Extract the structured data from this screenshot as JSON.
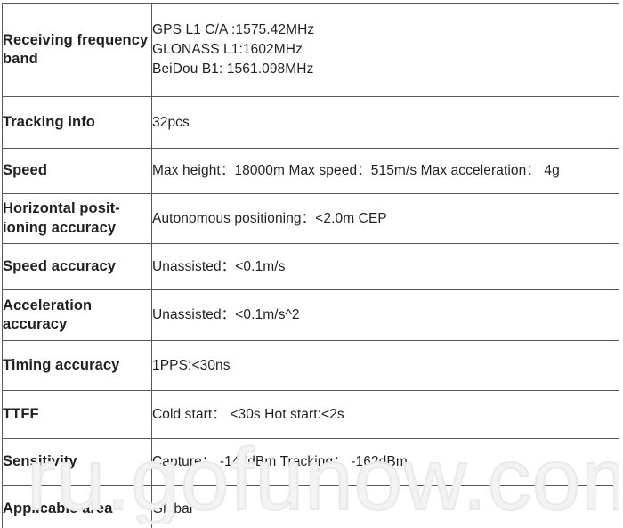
{
  "document": {
    "type": "specification-table",
    "watermark": "ru.gofunow.com",
    "watermark_color": "#e9e9e9",
    "text_color": "#231f20",
    "border_color": "#58595b",
    "background": "#ffffff"
  },
  "table": {
    "column_count": 2,
    "rows": [
      {
        "label": "Receiving\nfrequency band",
        "value": "GPS L1 C/A :1575.42MHz\nGLONASS L1:1602MHz\nBeiDou B1: 1561.098MHz"
      },
      {
        "label": "Tracking info",
        "value": "32pcs"
      },
      {
        "label": "Speed",
        "value": "Max height：18000m  Max speed：515m/s Max acceleration： 4g"
      },
      {
        "label": "Horizontal posit-\nioning accuracy",
        "value": "Autonomous positioning：<2.0m CEP"
      },
      {
        "label": "Speed accuracy",
        "value": "Unassisted：<0.1m/s"
      },
      {
        "label": "Acceleration\naccuracy",
        "value": "Unassisted：<0.1m/s^2"
      },
      {
        "label": "Timing accuracy",
        "value": "1PPS:<30ns"
      },
      {
        "label": "TTFF",
        "value": "Cold start： <30s Hot start:<2s"
      },
      {
        "label": "Sensitivity",
        "value": "Capture： -147dBm Tracking： -162dBm"
      },
      {
        "label": "Applicable area",
        "value": "Global"
      }
    ]
  }
}
